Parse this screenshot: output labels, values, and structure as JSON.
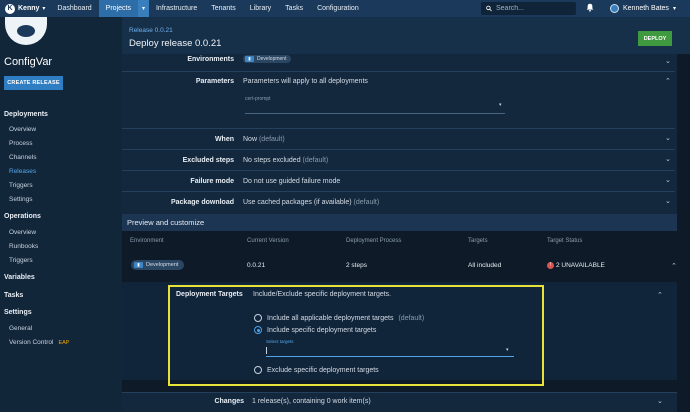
{
  "topnav": {
    "space": {
      "initial": "K",
      "name": "Kenny"
    },
    "items": [
      {
        "label": "Dashboard",
        "active": false
      },
      {
        "label": "Projects",
        "active": true
      },
      {
        "label": "Infrastructure",
        "active": false
      },
      {
        "label": "Tenants",
        "active": false
      },
      {
        "label": "Library",
        "active": false
      },
      {
        "label": "Tasks",
        "active": false
      },
      {
        "label": "Configuration",
        "active": false
      }
    ],
    "search_placeholder": "Search...",
    "user_name": "Kenneth Bates"
  },
  "sidebar": {
    "project_name": "ConfigVar",
    "create_release_label": "CREATE RELEASE",
    "deployments_title": "Deployments",
    "deployments_items": [
      "Overview",
      "Process",
      "Channels",
      "Releases",
      "Triggers",
      "Settings"
    ],
    "active_item": "Releases",
    "operations_title": "Operations",
    "operations_items": [
      "Overview",
      "Runbooks",
      "Triggers"
    ],
    "variables_title": "Variables",
    "tasks_title": "Tasks",
    "settings_title": "Settings",
    "settings_items": [
      "General",
      "Version Control"
    ],
    "eap_badge": "EAP"
  },
  "header": {
    "breadcrumb": "Release 0.0.21",
    "title": "Deploy release 0.0.21",
    "deploy_label": "DEPLOY"
  },
  "rows": {
    "environments": {
      "label": "Environments",
      "chip": "Development"
    },
    "parameters": {
      "label": "Parameters",
      "value": "Parameters will apply to all deployments",
      "field_label": "cert-prompt"
    },
    "when": {
      "label": "When",
      "value": "Now",
      "suffix": "(default)"
    },
    "excluded": {
      "label": "Excluded steps",
      "value": "No steps excluded",
      "suffix": "(default)"
    },
    "failure": {
      "label": "Failure mode",
      "value": "Do not use guided failure mode"
    },
    "package": {
      "label": "Package download",
      "value": "Use cached packages (if available)",
      "suffix": "(default)"
    }
  },
  "preview": {
    "title": "Preview and customize",
    "columns": [
      "Environment",
      "Current Version",
      "Deployment Process",
      "Targets",
      "Target Status"
    ],
    "row": {
      "environment": "Development",
      "version": "0.0.21",
      "process": "2 steps",
      "targets": "All included",
      "status": "2 UNAVAILABLE"
    }
  },
  "deployment_targets": {
    "label": "Deployment Targets",
    "description": "Include/Exclude specific deployment targets.",
    "options": [
      {
        "label": "Include all applicable deployment targets",
        "suffix": "(default)",
        "selected": false
      },
      {
        "label": "Include specific deployment targets",
        "suffix": "",
        "selected": true
      },
      {
        "label": "Exclude specific deployment targets",
        "suffix": "",
        "selected": false
      }
    ],
    "select_label": "Select targets"
  },
  "changes": {
    "label": "Changes",
    "value": "1 release(s), containing 0 work item(s)"
  },
  "colors": {
    "nav": "#1b3a5b",
    "accent": "#2e6ea8",
    "deploy": "#3f9a3f",
    "highlight": "#e6e23a",
    "error": "#d9534f"
  }
}
